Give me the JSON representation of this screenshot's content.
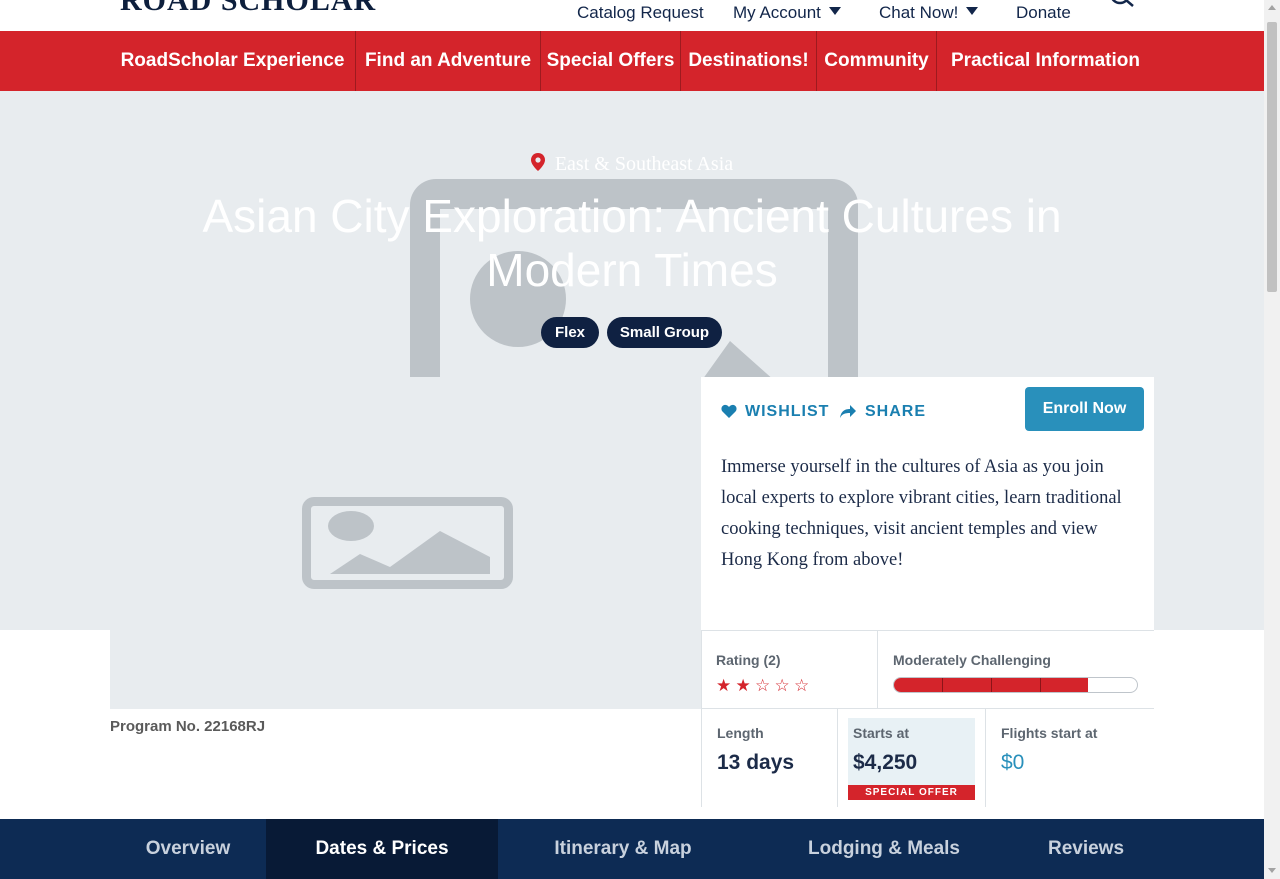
{
  "brand": {
    "logo_text": "ROAD SCHOLAR"
  },
  "utility_nav": {
    "catalog": "Catalog Request",
    "account": "My Account",
    "chat": "Chat Now!",
    "donate": "Donate"
  },
  "main_nav": {
    "items": [
      {
        "label": "RoadScholar Experience"
      },
      {
        "label": "Find an Adventure"
      },
      {
        "label": "Special Offers"
      },
      {
        "label": "Destinations!"
      },
      {
        "label": "Community"
      },
      {
        "label": "Practical Information"
      }
    ]
  },
  "hero": {
    "location": "East & Southeast Asia",
    "title": "Asian City Exploration: Ancient Cultures in Modern Times",
    "badges": [
      "Flex",
      "Small Group"
    ]
  },
  "program": {
    "number_text": "Program No. 22168RJ"
  },
  "card": {
    "wishlist": "WISHLIST",
    "share": "SHARE",
    "enroll": "Enroll Now",
    "description": "Immerse yourself in the cultures of Asia as you join local experts to explore vibrant cities, learn traditional cooking techniques, visit ancient temples and view Hong Kong from above!"
  },
  "stats": {
    "rating_label": "Rating (2)",
    "rating_value": 2,
    "rating_max": 5,
    "difficulty_label": "Moderately Challenging",
    "difficulty_level": 4,
    "difficulty_max": 5,
    "length_label": "Length",
    "length_value": "13 days",
    "price_label": "Starts at",
    "price_value": "$4,250",
    "offer_tag": "SPECIAL OFFER",
    "flights_label": "Flights start at",
    "flights_value": "$0"
  },
  "tabs": [
    {
      "label": "Overview",
      "active": false
    },
    {
      "label": "Dates & Prices",
      "active": true
    },
    {
      "label": "Itinerary & Map",
      "active": false
    },
    {
      "label": "Lodging & Meals",
      "active": false
    },
    {
      "label": "Reviews",
      "active": false
    }
  ],
  "colors": {
    "brand_red": "#d4242b",
    "navy": "#0d2b54",
    "accent_blue": "#2990bb"
  }
}
